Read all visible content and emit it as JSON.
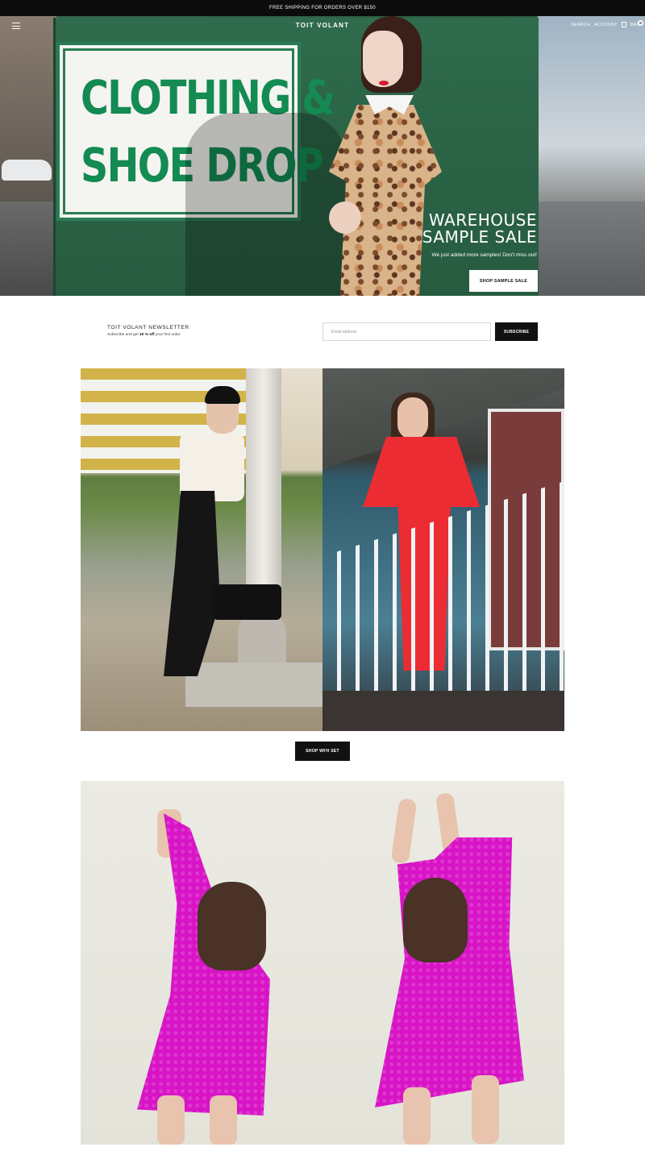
{
  "announcement": {
    "text": "FREE SHIPPING FOR ORDERS OVER $150"
  },
  "header": {
    "logo": "TOIT VOLANT",
    "search": "SEARCH",
    "account": "ACCOUNT",
    "bag": "BAG",
    "bag_count": "0"
  },
  "hero": {
    "sign_line1": "CLOTHING &",
    "sign_line2": "SHOE DROP",
    "title_line1": "WAREHOUSE",
    "title_line2": "SAMPLE SALE",
    "subtitle": "We just added more samples! Don't miss out!",
    "button": "SHOP SAMPLE SALE",
    "slides": 4,
    "active_slide": 4
  },
  "newsletter": {
    "title": "TOIT VOLANT NEWSLETTER",
    "sub_prefix": "Subscribe and get",
    "sub_highlight": "10 % off",
    "sub_suffix": "your first order",
    "placeholder": "Email address",
    "button": "SUBSCRIBE"
  },
  "wfh": {
    "button": "SHOP WFH SET"
  },
  "colors": {
    "accent_dark": "#111111",
    "sign_green": "#138b52",
    "dumpster_green": "#2e6046",
    "pink": "#d814c6",
    "red": "#ec2c33"
  }
}
